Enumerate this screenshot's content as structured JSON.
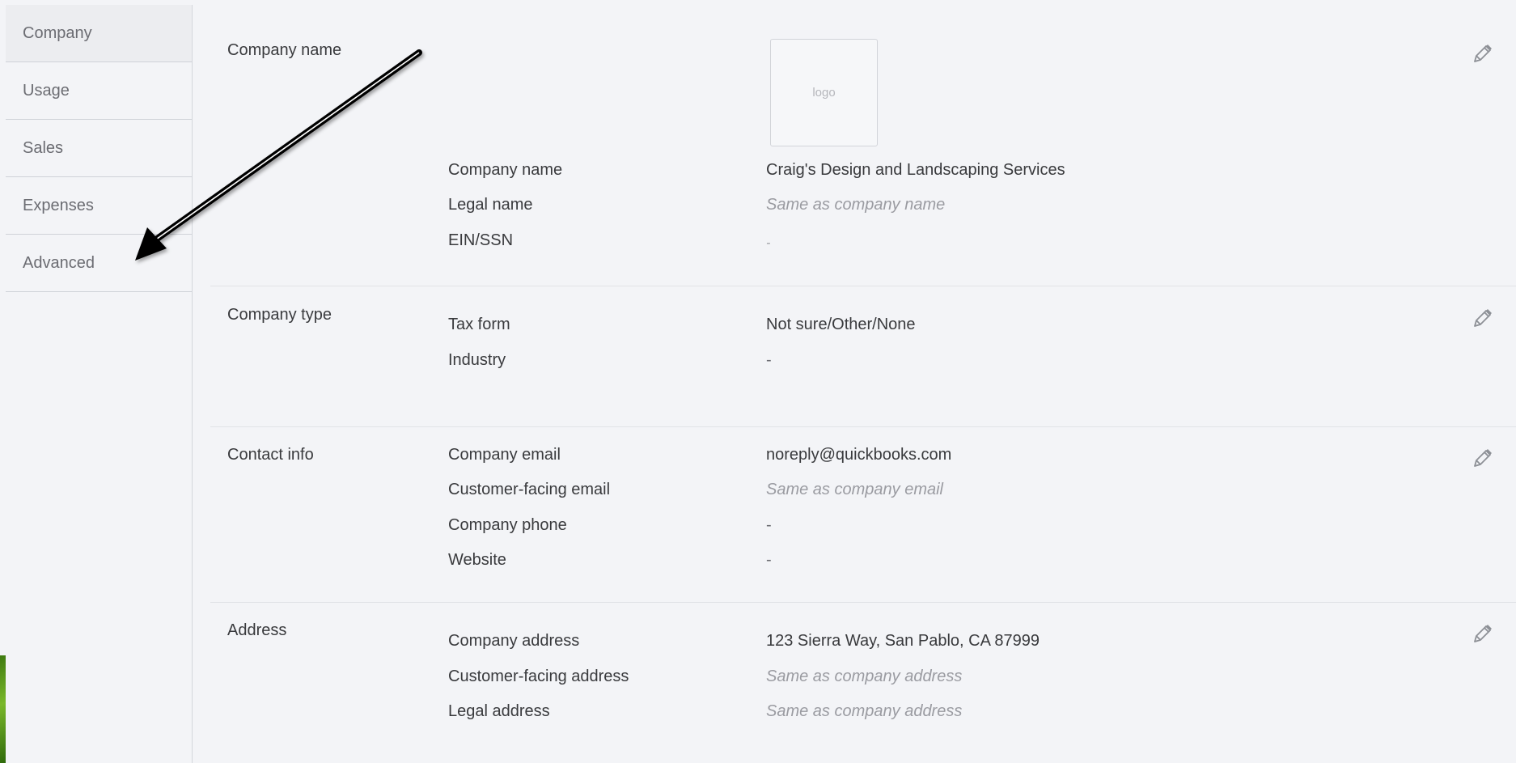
{
  "sidebar": {
    "items": [
      {
        "label": "Company",
        "active": true
      },
      {
        "label": "Usage"
      },
      {
        "label": "Sales"
      },
      {
        "label": "Expenses"
      },
      {
        "label": "Advanced"
      }
    ]
  },
  "sections": {
    "company_name": {
      "title": "Company name",
      "logo_placeholder": "logo",
      "rows": [
        {
          "label": "Company name",
          "value": "Craig's Design and Landscaping Services"
        },
        {
          "label": "Legal name",
          "value": "Same as company name"
        },
        {
          "label": "EIN/SSN",
          "value": "-"
        }
      ]
    },
    "company_type": {
      "title": "Company type",
      "rows": [
        {
          "label": "Tax form",
          "value": "Not sure/Other/None"
        },
        {
          "label": "Industry",
          "value": "-"
        }
      ]
    },
    "contact_info": {
      "title": "Contact info",
      "rows": [
        {
          "label": "Company email",
          "value": "noreply@quickbooks.com"
        },
        {
          "label": "Customer-facing email",
          "value": "Same as company email"
        },
        {
          "label": "Company phone",
          "value": "-"
        },
        {
          "label": "Website",
          "value": "-"
        }
      ]
    },
    "address": {
      "title": "Address",
      "rows": [
        {
          "label": "Company address",
          "value": "123 Sierra Way, San Pablo, CA 87999"
        },
        {
          "label": "Customer-facing address",
          "value": "Same as company address"
        },
        {
          "label": "Legal address",
          "value": "Same as company address"
        }
      ]
    }
  },
  "icons": {
    "edit": "pencil-icon",
    "annotation": "arrow-icon"
  },
  "colors": {
    "background": "#f3f4f7",
    "text": "#393a3d",
    "muted": "#9a9ba1",
    "arrow": "#000000"
  }
}
